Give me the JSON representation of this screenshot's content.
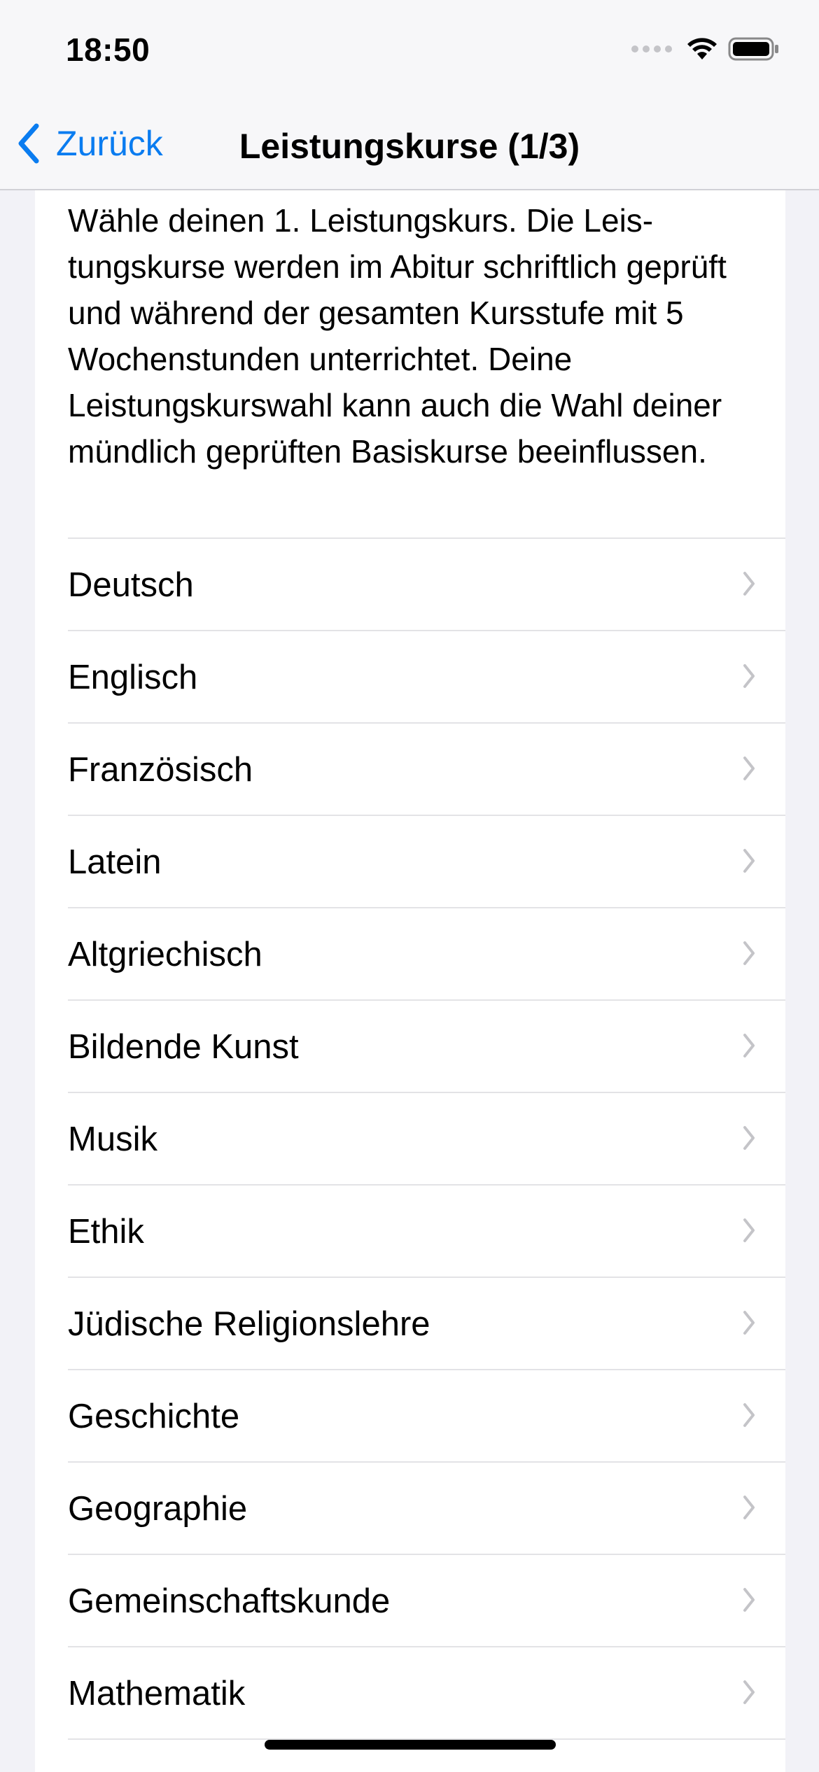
{
  "status_bar": {
    "time": "18:50",
    "icons": [
      "cellular-signal-icon",
      "wifi-icon",
      "battery-icon"
    ]
  },
  "nav": {
    "back_label": "Zurück",
    "title": "Leistungskurse (1/3)"
  },
  "description": "Wähle deinen 1. Leistungskurs. Die Leis­tungskurse werden im Abitur schriftlich geprüft und während der gesamten Kurs­stufe mit 5 Wochenstunden unterrichtet. Deine Leistungskurswahl kann auch die Wahl deiner mündlich geprüften Basis­kurse beeinflussen.",
  "courses": [
    {
      "label": "Deutsch"
    },
    {
      "label": "Englisch"
    },
    {
      "label": "Französisch"
    },
    {
      "label": "Latein"
    },
    {
      "label": "Altgriechisch"
    },
    {
      "label": "Bildende Kunst"
    },
    {
      "label": "Musik"
    },
    {
      "label": "Ethik"
    },
    {
      "label": "Jüdische Religionslehre"
    },
    {
      "label": "Geschichte"
    },
    {
      "label": "Geographie"
    },
    {
      "label": "Gemeinschaftskunde"
    },
    {
      "label": "Mathematik"
    }
  ],
  "colors": {
    "accent": "#0A84FF",
    "background": "#F2F2F7",
    "separator": "#E3E3E6",
    "chevron": "#C4C4C8"
  }
}
